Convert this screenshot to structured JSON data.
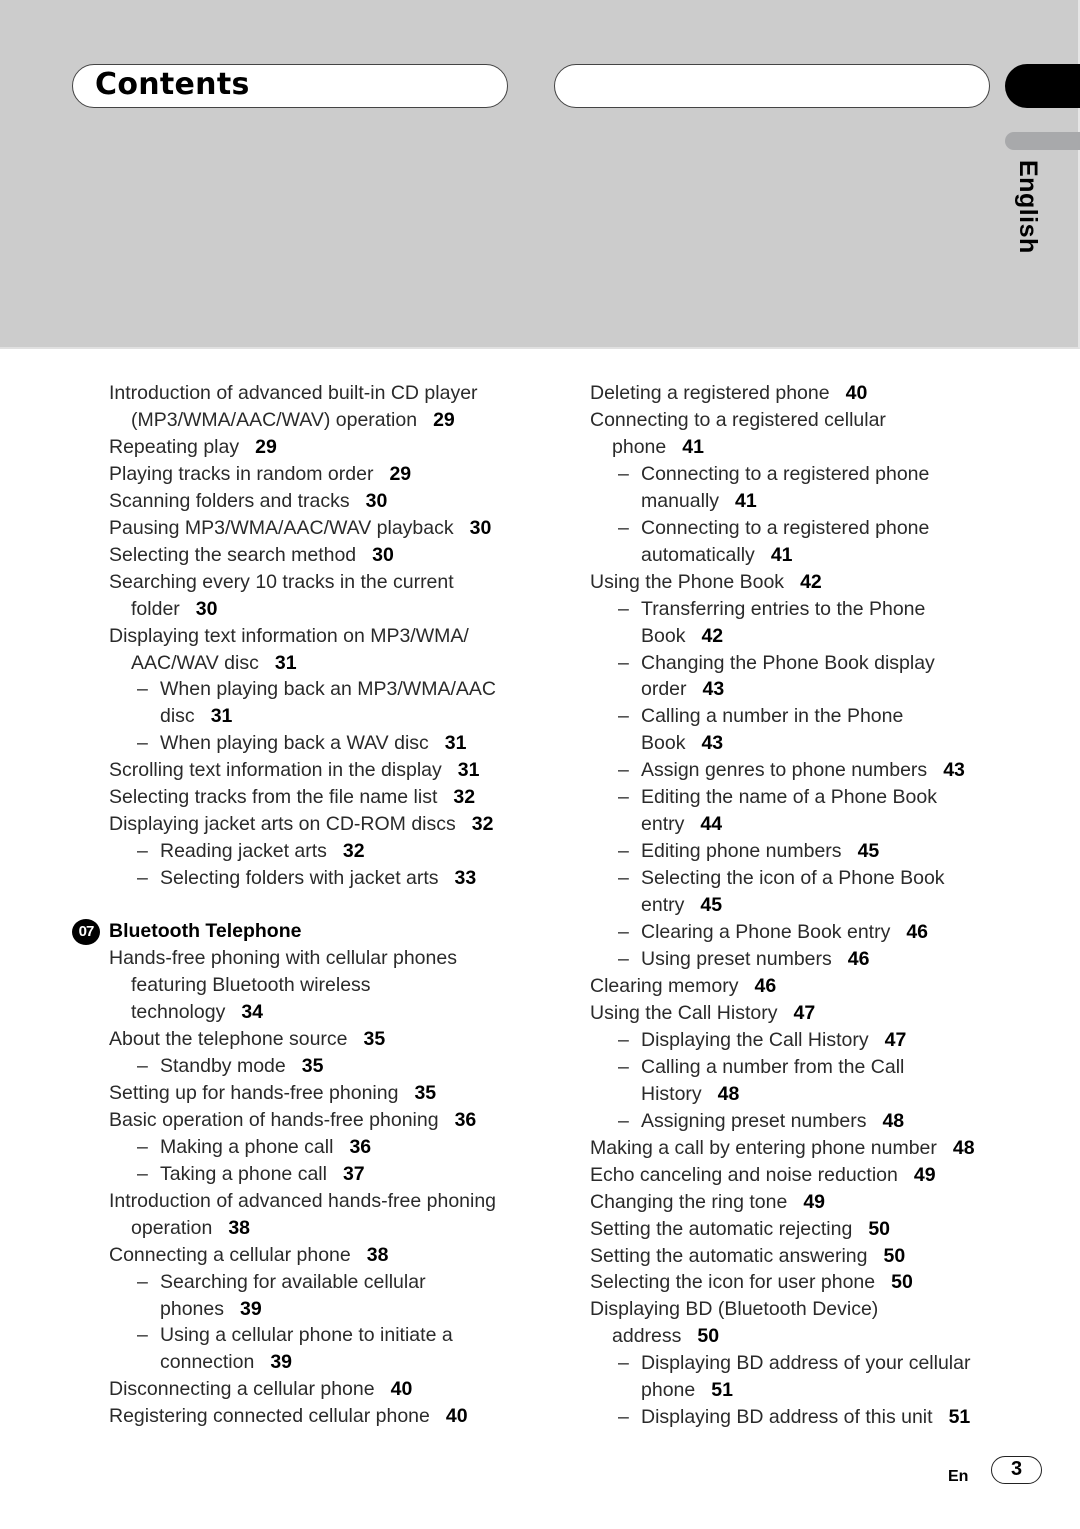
{
  "header": {
    "title": "Contents",
    "language_tab": "English"
  },
  "left_column": {
    "entries_before_section": [
      {
        "level": 1,
        "lines": [
          "Introduction of advanced built-in CD player",
          "(MP3/WMA/AAC/WAV) operation"
        ],
        "page": "29"
      },
      {
        "level": 1,
        "lines": [
          "Repeating play"
        ],
        "page": "29"
      },
      {
        "level": 1,
        "lines": [
          "Playing tracks in random order"
        ],
        "page": "29"
      },
      {
        "level": 1,
        "lines": [
          "Scanning folders and tracks"
        ],
        "page": "30"
      },
      {
        "level": 1,
        "lines": [
          "Pausing MP3/WMA/AAC/WAV playback"
        ],
        "page": "30"
      },
      {
        "level": 1,
        "lines": [
          "Selecting the search method"
        ],
        "page": "30"
      },
      {
        "level": 1,
        "lines": [
          "Searching every 10 tracks in the current",
          "folder"
        ],
        "page": "30"
      },
      {
        "level": 1,
        "lines": [
          "Displaying text information on MP3/WMA/",
          "AAC/WAV disc"
        ],
        "page": "31"
      },
      {
        "level": 2,
        "lines": [
          "When playing back an MP3/WMA/AAC",
          "disc"
        ],
        "page": "31"
      },
      {
        "level": 2,
        "lines": [
          "When playing back a WAV disc"
        ],
        "page": "31"
      },
      {
        "level": 1,
        "lines": [
          "Scrolling text information in the display"
        ],
        "page": "31"
      },
      {
        "level": 1,
        "lines": [
          "Selecting tracks from the file name list"
        ],
        "page": "32"
      },
      {
        "level": 1,
        "lines": [
          "Displaying jacket arts on CD-ROM discs"
        ],
        "page": "32"
      },
      {
        "level": 2,
        "lines": [
          "Reading jacket arts"
        ],
        "page": "32"
      },
      {
        "level": 2,
        "lines": [
          "Selecting folders with jacket arts"
        ],
        "page": "33"
      }
    ],
    "section": {
      "number": "07",
      "title": "Bluetooth Telephone"
    },
    "entries_after_section": [
      {
        "level": 1,
        "lines": [
          "Hands-free phoning with cellular phones",
          "featuring Bluetooth wireless",
          "technology"
        ],
        "page": "34"
      },
      {
        "level": 1,
        "lines": [
          "About the telephone source"
        ],
        "page": "35"
      },
      {
        "level": 2,
        "lines": [
          "Standby mode"
        ],
        "page": "35"
      },
      {
        "level": 1,
        "lines": [
          "Setting up for hands-free phoning"
        ],
        "page": "35"
      },
      {
        "level": 1,
        "lines": [
          "Basic operation of hands-free phoning"
        ],
        "page": "36"
      },
      {
        "level": 2,
        "lines": [
          "Making a phone call"
        ],
        "page": "36"
      },
      {
        "level": 2,
        "lines": [
          "Taking a phone call"
        ],
        "page": "37"
      },
      {
        "level": 1,
        "lines": [
          "Introduction of advanced hands-free phoning",
          "operation"
        ],
        "page": "38"
      },
      {
        "level": 1,
        "lines": [
          "Connecting a cellular phone"
        ],
        "page": "38"
      },
      {
        "level": 2,
        "lines": [
          "Searching for available cellular",
          "phones"
        ],
        "page": "39"
      },
      {
        "level": 2,
        "lines": [
          "Using a cellular phone to initiate a",
          "connection"
        ],
        "page": "39"
      },
      {
        "level": 1,
        "lines": [
          "Disconnecting a cellular phone"
        ],
        "page": "40"
      },
      {
        "level": 1,
        "lines": [
          "Registering connected cellular phone"
        ],
        "page": "40"
      }
    ]
  },
  "right_column": {
    "entries": [
      {
        "level": 1,
        "lines": [
          "Deleting a registered phone"
        ],
        "page": "40"
      },
      {
        "level": 1,
        "lines": [
          "Connecting to a registered cellular",
          "phone"
        ],
        "page": "41"
      },
      {
        "level": 2,
        "lines": [
          "Connecting to a registered phone",
          "manually"
        ],
        "page": "41"
      },
      {
        "level": 2,
        "lines": [
          "Connecting to a registered phone",
          "automatically"
        ],
        "page": "41"
      },
      {
        "level": 1,
        "lines": [
          "Using the Phone Book"
        ],
        "page": "42"
      },
      {
        "level": 2,
        "lines": [
          "Transferring entries to the Phone",
          "Book"
        ],
        "page": "42"
      },
      {
        "level": 2,
        "lines": [
          "Changing the Phone Book display",
          "order"
        ],
        "page": "43"
      },
      {
        "level": 2,
        "lines": [
          "Calling a number in the Phone",
          "Book"
        ],
        "page": "43"
      },
      {
        "level": 2,
        "lines": [
          "Assign genres to phone numbers"
        ],
        "page": "43"
      },
      {
        "level": 2,
        "lines": [
          "Editing the name of a Phone Book",
          "entry"
        ],
        "page": "44"
      },
      {
        "level": 2,
        "lines": [
          "Editing phone numbers"
        ],
        "page": "45"
      },
      {
        "level": 2,
        "lines": [
          "Selecting the icon of a Phone Book",
          "entry"
        ],
        "page": "45"
      },
      {
        "level": 2,
        "lines": [
          "Clearing a Phone Book entry"
        ],
        "page": "46"
      },
      {
        "level": 2,
        "lines": [
          "Using preset numbers"
        ],
        "page": "46"
      },
      {
        "level": 1,
        "lines": [
          "Clearing memory"
        ],
        "page": "46"
      },
      {
        "level": 1,
        "lines": [
          "Using the Call History"
        ],
        "page": "47"
      },
      {
        "level": 2,
        "lines": [
          "Displaying the Call History"
        ],
        "page": "47"
      },
      {
        "level": 2,
        "lines": [
          "Calling a number from the Call",
          "History"
        ],
        "page": "48"
      },
      {
        "level": 2,
        "lines": [
          "Assigning preset numbers"
        ],
        "page": "48"
      },
      {
        "level": 1,
        "lines": [
          "Making a call by entering phone number"
        ],
        "page": "48"
      },
      {
        "level": 1,
        "lines": [
          "Echo canceling and noise reduction"
        ],
        "page": "49"
      },
      {
        "level": 1,
        "lines": [
          "Changing the ring tone"
        ],
        "page": "49"
      },
      {
        "level": 1,
        "lines": [
          "Setting the automatic rejecting"
        ],
        "page": "50"
      },
      {
        "level": 1,
        "lines": [
          "Setting the automatic answering"
        ],
        "page": "50"
      },
      {
        "level": 1,
        "lines": [
          "Selecting the icon for user phone"
        ],
        "page": "50"
      },
      {
        "level": 1,
        "lines": [
          "Displaying BD (Bluetooth Device)",
          "address"
        ],
        "page": "50"
      },
      {
        "level": 2,
        "lines": [
          "Displaying BD address of your cellular",
          "phone"
        ],
        "page": "51"
      },
      {
        "level": 2,
        "lines": [
          "Displaying BD address of this unit"
        ],
        "page": "51"
      }
    ]
  },
  "footer": {
    "language_code": "En",
    "page_number": "3"
  },
  "dash_glyph": "–"
}
